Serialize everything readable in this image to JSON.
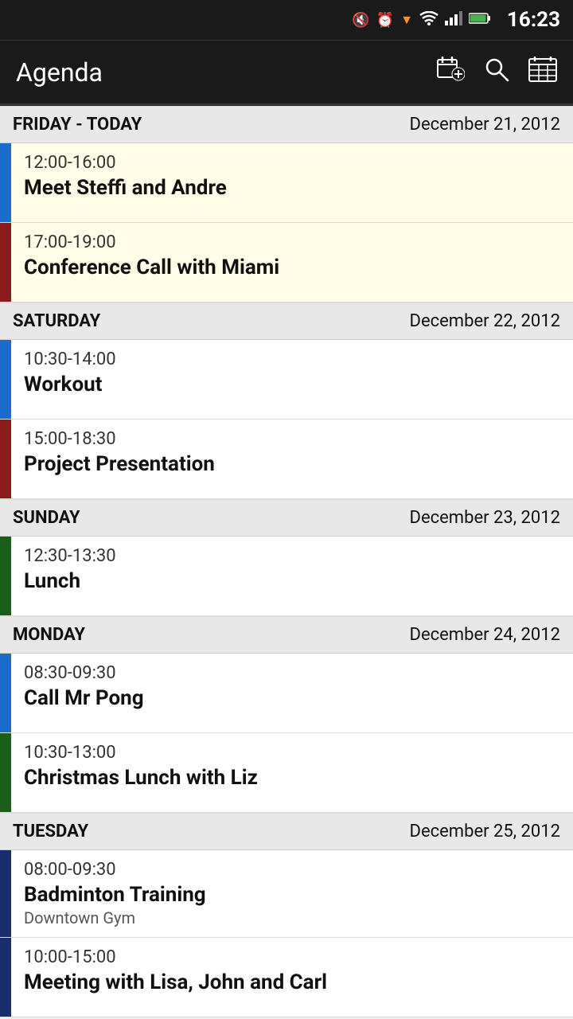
{
  "statusBar": {
    "time": "16:23",
    "icons": [
      "🔇",
      "⏰",
      "📶",
      "📶",
      "🔋"
    ]
  },
  "toolbar": {
    "title": "Agenda",
    "addEventLabel": "Add Event",
    "searchLabel": "Search",
    "calendarLabel": "Calendar View"
  },
  "days": [
    {
      "id": "friday",
      "dayName": "FRIDAY - TODAY",
      "date": "December 21, 2012",
      "isToday": true,
      "events": [
        {
          "id": "fri-1",
          "time": "12:00-16:00",
          "title": "Meet Steffi and Andre",
          "subtitle": "",
          "stripeColor": "blue"
        },
        {
          "id": "fri-2",
          "time": "17:00-19:00",
          "title": "Conference Call with Miami",
          "subtitle": "",
          "stripeColor": "dark-red"
        }
      ]
    },
    {
      "id": "saturday",
      "dayName": "SATURDAY",
      "date": "December 22, 2012",
      "isToday": false,
      "events": [
        {
          "id": "sat-1",
          "time": "10:30-14:00",
          "title": "Workout",
          "subtitle": "",
          "stripeColor": "blue"
        },
        {
          "id": "sat-2",
          "time": "15:00-18:30",
          "title": "Project Presentation",
          "subtitle": "",
          "stripeColor": "dark-red"
        }
      ]
    },
    {
      "id": "sunday",
      "dayName": "SUNDAY",
      "date": "December 23, 2012",
      "isToday": false,
      "events": [
        {
          "id": "sun-1",
          "time": "12:30-13:30",
          "title": "Lunch",
          "subtitle": "",
          "stripeColor": "green"
        }
      ]
    },
    {
      "id": "monday",
      "dayName": "MONDAY",
      "date": "December 24, 2012",
      "isToday": false,
      "events": [
        {
          "id": "mon-1",
          "time": "08:30-09:30",
          "title": "Call Mr Pong",
          "subtitle": "",
          "stripeColor": "blue"
        },
        {
          "id": "mon-2",
          "time": "10:30-13:00",
          "title": "Christmas Lunch with Liz",
          "subtitle": "",
          "stripeColor": "green"
        }
      ]
    },
    {
      "id": "tuesday",
      "dayName": "TUESDAY",
      "date": "December 25, 2012",
      "isToday": false,
      "events": [
        {
          "id": "tue-1",
          "time": "08:00-09:30",
          "title": "Badminton Training",
          "subtitle": "Downtown Gym",
          "stripeColor": "dark-blue"
        },
        {
          "id": "tue-2",
          "time": "10:00-15:00",
          "title": "Meeting with Lisa, John and Carl",
          "subtitle": "",
          "stripeColor": "dark-blue"
        }
      ]
    }
  ]
}
